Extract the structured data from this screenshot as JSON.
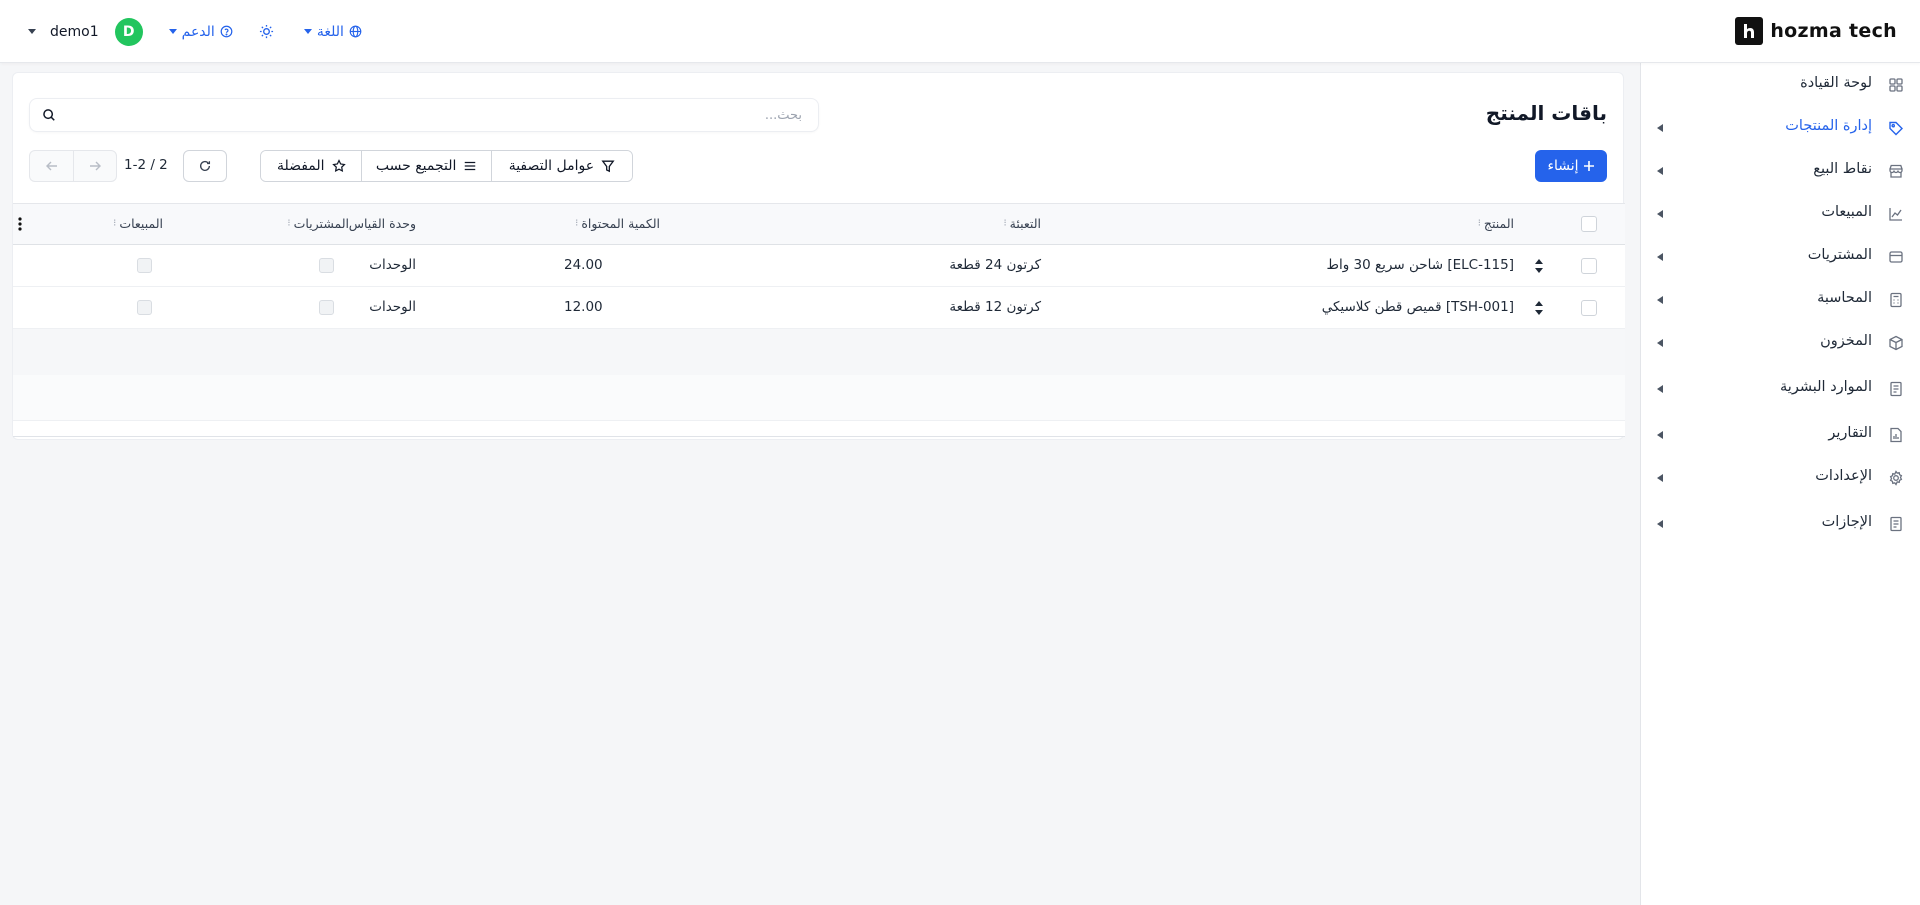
{
  "brand": {
    "name": "hozma tech",
    "mark": "h"
  },
  "topbar": {
    "user": {
      "name": "demo1",
      "initial": "D"
    },
    "support_label": "الدعم",
    "language_label": "اللغة"
  },
  "sidebar": {
    "items": [
      {
        "label": "لوحة القيادة",
        "icon": "grid-icon",
        "expandable": false,
        "active": false
      },
      {
        "label": "إدارة المنتجات",
        "icon": "tag-icon",
        "expandable": true,
        "active": true
      },
      {
        "label": "نقاط البيع",
        "icon": "store-icon",
        "expandable": true,
        "active": false
      },
      {
        "label": "المبيعات",
        "icon": "chart-line-icon",
        "expandable": true,
        "active": false
      },
      {
        "label": "المشتريات",
        "icon": "wallet-icon",
        "expandable": true,
        "active": false
      },
      {
        "label": "المحاسبة",
        "icon": "calculator-icon",
        "expandable": true,
        "active": false
      },
      {
        "label": "المخزون",
        "icon": "box-icon",
        "expandable": true,
        "active": false
      },
      {
        "label": "الموارد البشرية",
        "icon": "document-icon",
        "expandable": true,
        "active": false
      },
      {
        "label": "التقارير",
        "icon": "report-icon",
        "expandable": true,
        "active": false
      },
      {
        "label": "الإعدادات",
        "icon": "gear-icon",
        "expandable": true,
        "active": false
      },
      {
        "label": "الإجازات",
        "icon": "document-icon",
        "expandable": true,
        "active": false
      }
    ]
  },
  "page": {
    "title": "باقات المنتج",
    "search_placeholder": "بحث...",
    "create_label": "إنشاء",
    "filters_label": "عوامل التصفية",
    "group_by_label": "التجميع حسب",
    "favorites_label": "المفضلة",
    "pager": "1-2 / 2"
  },
  "table": {
    "columns": {
      "product": "المنتج",
      "packaging": "التعبئة",
      "contained_qty": "الكمية المحتواة",
      "uom": "وحدة القياس",
      "purchases": "المشتريات",
      "sales": "المبيعات"
    },
    "rows": [
      {
        "product": "[ELC-115] شاحن سريع 30 واط",
        "packaging": "كرتون 24 قطعة",
        "contained_qty": "24.00",
        "uom": "الوحدات",
        "purchases": false,
        "sales": false
      },
      {
        "product": "[TSH-001] قميص قطن كلاسيكي",
        "packaging": "كرتون 12 قطعة",
        "contained_qty": "12.00",
        "uom": "الوحدات",
        "purchases": false,
        "sales": false
      }
    ]
  },
  "colors": {
    "accent": "#2563eb",
    "avatar": "#22c55e",
    "background": "#f5f6f8"
  }
}
